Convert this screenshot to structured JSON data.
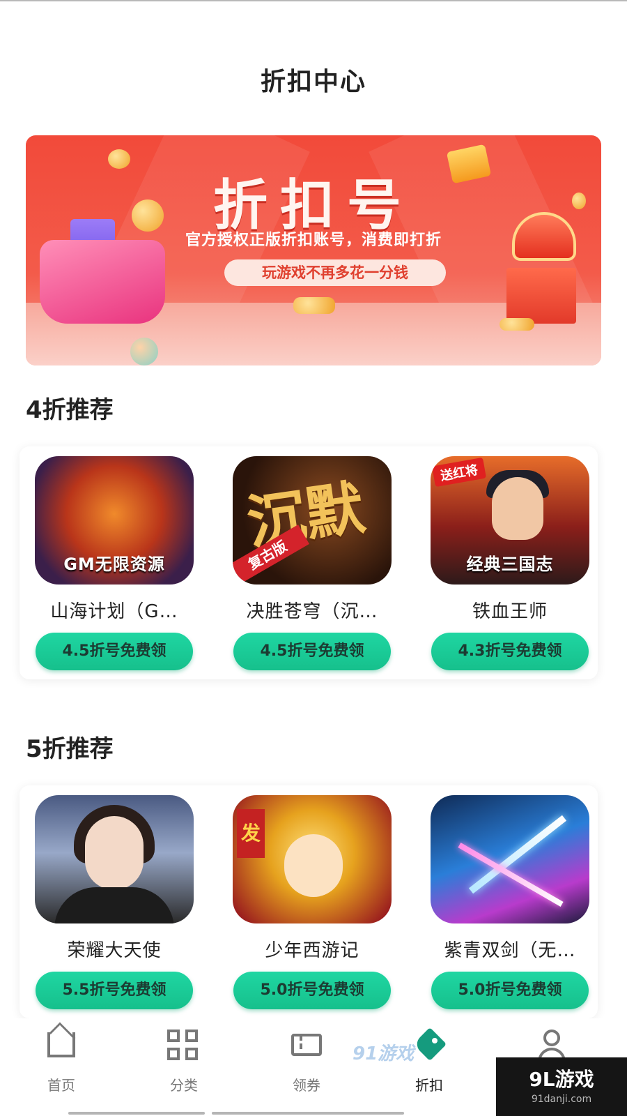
{
  "header": {
    "title": "折扣中心"
  },
  "banner": {
    "title": "折扣号",
    "subtitle": "官方授权正版折扣账号，消费即打折",
    "pill": "玩游戏不再多花一分钱"
  },
  "sections": [
    {
      "title": "4折推荐",
      "games": [
        {
          "name": "山海计划（G…",
          "button": "4.5折号免费领",
          "icon_text": "GM无限资源",
          "icon": "game-icon-shanhai"
        },
        {
          "name": "决胜苍穹（沉…",
          "button": "4.5折号免费领",
          "icon_text": "沉默",
          "icon_ribbon": "复古版",
          "icon": "game-icon-juesheng"
        },
        {
          "name": "铁血王师",
          "button": "4.3折号免费领",
          "icon_text": "经典三国志",
          "icon_tag": "送红将",
          "icon": "game-icon-tiexue"
        }
      ]
    },
    {
      "title": "5折推荐",
      "games": [
        {
          "name": "荣耀大天使",
          "button": "5.5折号免费领",
          "icon": "game-icon-rongyao"
        },
        {
          "name": "少年西游记",
          "button": "5.0折号免费领",
          "icon_sign": "发",
          "icon": "game-icon-shaonian"
        },
        {
          "name": "紫青双剑（无…",
          "button": "5.0折号免费领",
          "icon": "game-icon-ziqing"
        }
      ]
    }
  ],
  "bottom_nav": {
    "items": [
      {
        "label": "首页",
        "icon": "home-icon",
        "active": false
      },
      {
        "label": "分类",
        "icon": "category-grid-icon",
        "active": false
      },
      {
        "label": "领券",
        "icon": "coupon-icon",
        "active": false
      },
      {
        "label": "折扣",
        "icon": "discount-tag-icon",
        "active": true
      },
      {
        "label": "",
        "icon": "profile-icon",
        "active": false
      }
    ]
  },
  "watermark": {
    "mid": "91游戏",
    "corner": "9L游戏",
    "corner_sub": "91danji.com"
  },
  "colors": {
    "accent": "#16c08c",
    "banner": "#f24a3a",
    "active_tab": "#159b7e"
  }
}
